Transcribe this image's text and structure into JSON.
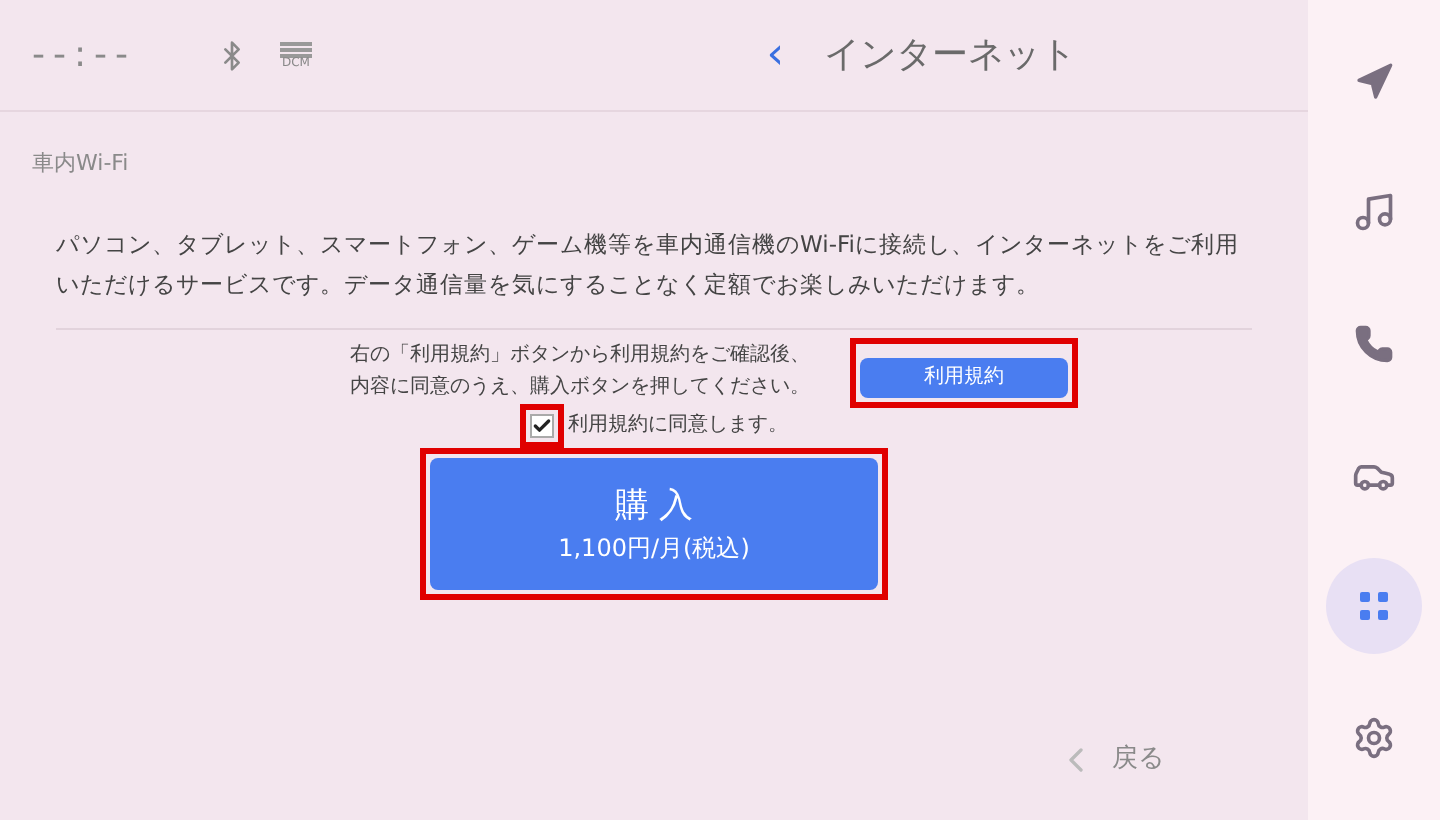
{
  "status_bar": {
    "clock": "--:--",
    "network_label": "DCM"
  },
  "header": {
    "back_icon": "‹",
    "title": "インターネット"
  },
  "section_label": "車内Wi-Fi",
  "description": "パソコン、タブレット、スマートフォン、ゲーム機等を車内通信機のWi-Fiに接続し、インターネットをご利用いただけるサービスです。データ通信量を気にすることなく定額でお楽しみいただけます。",
  "instructions": [
    "右の「利用規約」ボタンから利用規約をご確認後、",
    "内容に同意のうえ、購入ボタンを押してください。"
  ],
  "terms_button": {
    "label": "利用規約",
    "highlighted": true
  },
  "agree_checkbox": {
    "label": "利用規約に同意します。",
    "checked": true,
    "highlighted": true
  },
  "purchase_button": {
    "label": "購 入",
    "price": "1,100円/月(税込)",
    "highlighted": true
  },
  "back_button": {
    "label": "戻る"
  },
  "sidebar": {
    "items": [
      {
        "selected": false
      },
      {
        "selected": false
      },
      {
        "selected": false
      },
      {
        "selected": false
      },
      {
        "selected": true
      },
      {
        "selected": false
      }
    ]
  }
}
